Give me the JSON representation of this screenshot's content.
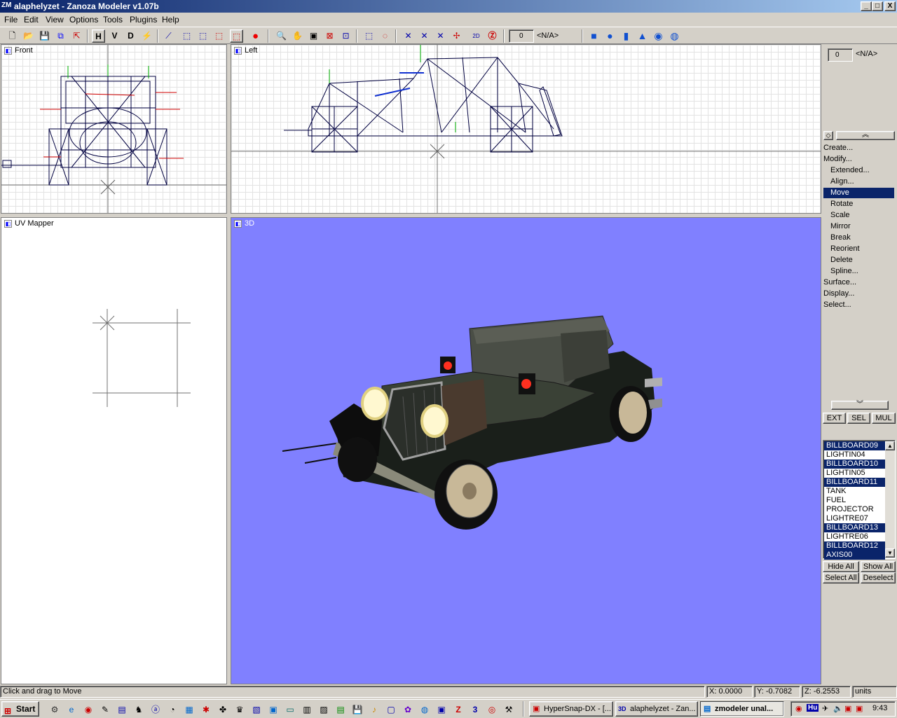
{
  "window": {
    "title": "alaphelyzet - Zanoza Modeler v1.07b",
    "app_icon": "ZM"
  },
  "title_buttons": {
    "minimize": "_",
    "maximize": "□",
    "close": "X"
  },
  "menu": [
    "File",
    "Edit",
    "View",
    "Options",
    "Tools",
    "Plugins",
    "Help"
  ],
  "toolbar": {
    "h": "H",
    "v": "V",
    "d": "D",
    "na_value": "0",
    "na_label": "<N/A>"
  },
  "viewports": {
    "front": "Front",
    "left": "Left",
    "uv": "UV Mapper",
    "view3d": "3D"
  },
  "panel": {
    "na_value": "0",
    "na_label": "<N/A>",
    "commands": [
      {
        "label": "Create...",
        "sub": false,
        "active": false
      },
      {
        "label": "Modify...",
        "sub": false,
        "active": false
      },
      {
        "label": "Extended...",
        "sub": true,
        "active": false
      },
      {
        "label": "Align...",
        "sub": true,
        "active": false
      },
      {
        "label": "Move",
        "sub": true,
        "active": true
      },
      {
        "label": "Rotate",
        "sub": true,
        "active": false
      },
      {
        "label": "Scale",
        "sub": true,
        "active": false
      },
      {
        "label": "Mirror",
        "sub": true,
        "active": false
      },
      {
        "label": "Break",
        "sub": true,
        "active": false
      },
      {
        "label": "Reorient",
        "sub": true,
        "active": false
      },
      {
        "label": "Delete",
        "sub": true,
        "active": false
      },
      {
        "label": "Spline...",
        "sub": true,
        "active": false
      },
      {
        "label": "Surface...",
        "sub": false,
        "active": false
      },
      {
        "label": "Display...",
        "sub": false,
        "active": false
      },
      {
        "label": "Select...",
        "sub": false,
        "active": false
      }
    ],
    "mode_buttons": [
      "EXT",
      "SEL",
      "MUL"
    ],
    "objects": [
      {
        "name": "BILLBOARD09",
        "selected": true
      },
      {
        "name": "LIGHTIN04",
        "selected": false
      },
      {
        "name": "BILLBOARD10",
        "selected": true
      },
      {
        "name": "LIGHTIN05",
        "selected": false
      },
      {
        "name": "BILLBOARD11",
        "selected": true
      },
      {
        "name": "TANK",
        "selected": false
      },
      {
        "name": "FUEL",
        "selected": false
      },
      {
        "name": "PROJECTOR",
        "selected": false
      },
      {
        "name": "LIGHTRE07",
        "selected": false
      },
      {
        "name": "BILLBOARD13",
        "selected": true
      },
      {
        "name": "LIGHTRE06",
        "selected": false
      },
      {
        "name": "BILLBOARD12",
        "selected": true
      },
      {
        "name": "AXIS00",
        "selected": true
      }
    ],
    "hide_all": "Hide All",
    "show_all": "Show All",
    "select_all": "Select All",
    "deselect": "Deselect"
  },
  "status": {
    "hint": "Click and drag to Move",
    "x": "X: 0.0000",
    "y": "Y: -0.7082",
    "z": "Z: -6.2553",
    "units": "units"
  },
  "taskbar": {
    "start": "Start",
    "tasks": [
      "HyperSnap-DX - [...",
      "alaphelyzet - Zan...",
      "zmodeler unal..."
    ],
    "clock": "9:43",
    "lang": "Hu"
  },
  "colors": {
    "selection": "#0a246a",
    "view3d_bg": "#8080ff",
    "wire": "#000040"
  }
}
